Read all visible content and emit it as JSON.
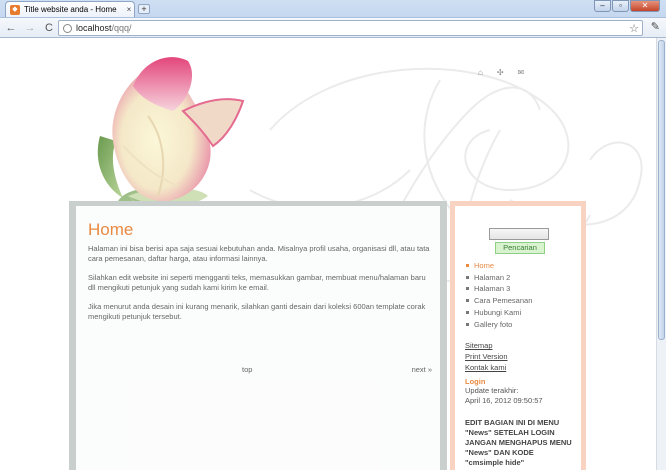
{
  "browser": {
    "tab_title": "Title website anda - Home",
    "tab_close": "×",
    "new_tab": "+",
    "win_min": "–",
    "win_max": "▫",
    "win_close": "✕",
    "back": "←",
    "forward": "→",
    "reload": "C",
    "url_host": "localhost",
    "url_path": "/qqq/",
    "star": "☆",
    "wrench": "✎"
  },
  "header": {
    "icons": [
      "home-icon",
      "sitemap-icon",
      "mail-icon"
    ],
    "icon_glyphs": [
      "⌂",
      "✣",
      "✉"
    ]
  },
  "main": {
    "title": "Home",
    "paragraphs": [
      "Halaman ini bisa berisi apa saja sesuai kebutuhan anda. Misalnya profil usaha, organisasi dll, atau tata cara pemesanan, daftar harga, atau informasi lainnya.",
      "Silahkan edit website ini seperti mengganti teks, memasukkan gambar, membuat menu/halaman baru dll mengikuti petunjuk yang sudah kami kirim ke email.",
      "Jika menurut anda desain ini kurang menarik, silahkan ganti desain dari koleksi 600an template corak mengikuti petunjuk tersebut."
    ],
    "top_link": "top",
    "next_link": "next »"
  },
  "sidebar": {
    "search_button": "Pencarian",
    "menu": [
      "Home",
      "Halaman 2",
      "Halaman 3",
      "Cara Pemesanan",
      "Hubungi Kami",
      "Gallery foto"
    ],
    "links": [
      "Sitemap",
      "Print Version",
      "Kontak kami"
    ],
    "login_title": "Login",
    "update_label": "Update terakhir:",
    "update_value": "April 16, 2012 09:50:57",
    "note": "EDIT BAGIAN INI DI MENU \"News\" SETELAH LOGIN JANGAN MENGHAPUS MENU \"News\" DAN KODE \"cmsimple hide\""
  },
  "colors": {
    "accent_orange": "#e98a43",
    "sidebar_border": "#f9d3c2",
    "main_border": "#c9cfcd"
  }
}
